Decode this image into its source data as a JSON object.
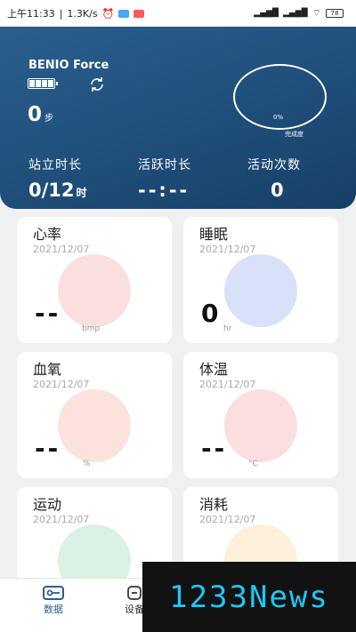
{
  "status_bar": {
    "time": "上午11:33",
    "speed": "1.3K/s",
    "battery": "78",
    "colors": {
      "weather": "#4aa3ff",
      "notify": "#ff5a5a"
    }
  },
  "device": {
    "name": "BENIO Force",
    "steps_value": "0",
    "steps_unit": "步",
    "progress_pct": "0%",
    "progress_label": "完成度",
    "battery_icon": "battery-full-icon",
    "sync_icon": "sync-icon"
  },
  "stats": [
    {
      "label": "站立时长",
      "value": "0/12",
      "unit": "时"
    },
    {
      "label": "活跃时长",
      "value": "--:--",
      "unit": ""
    },
    {
      "label": "活动次数",
      "value": "0",
      "unit": ""
    }
  ],
  "cards": [
    {
      "title": "心率",
      "date": "2021/12/07",
      "value": "--",
      "unit": "bmp",
      "icon": "heart-icon",
      "color": "#e84b4b"
    },
    {
      "title": "睡眠",
      "date": "2021/12/07",
      "value": "0",
      "unit": "hr",
      "icon": "moon-icon",
      "color": "#2e5bd6"
    },
    {
      "title": "血氧",
      "date": "2021/12/07",
      "value": "--",
      "unit": "%",
      "icon": "blood-oxygen-icon",
      "color": "#e8603c"
    },
    {
      "title": "体温",
      "date": "2021/12/07",
      "value": "--",
      "unit": "°C",
      "icon": "thermometer-icon",
      "color": "#e84b4b"
    },
    {
      "title": "运动",
      "date": "2021/12/07",
      "value": "",
      "unit": "",
      "icon": "footprints-icon",
      "color": "#35b36b"
    },
    {
      "title": "消耗",
      "date": "2021/12/07",
      "value": "",
      "unit": "",
      "icon": "flame-icon",
      "color": "#f3b33a"
    }
  ],
  "tabbar": {
    "items": [
      {
        "label": "数据",
        "icon": "data-icon",
        "active": true,
        "color": "#2b5f8e"
      },
      {
        "label": "设备",
        "icon": "device-icon",
        "active": false,
        "color": "#333333"
      }
    ]
  },
  "watermark": {
    "text": "1233News"
  }
}
